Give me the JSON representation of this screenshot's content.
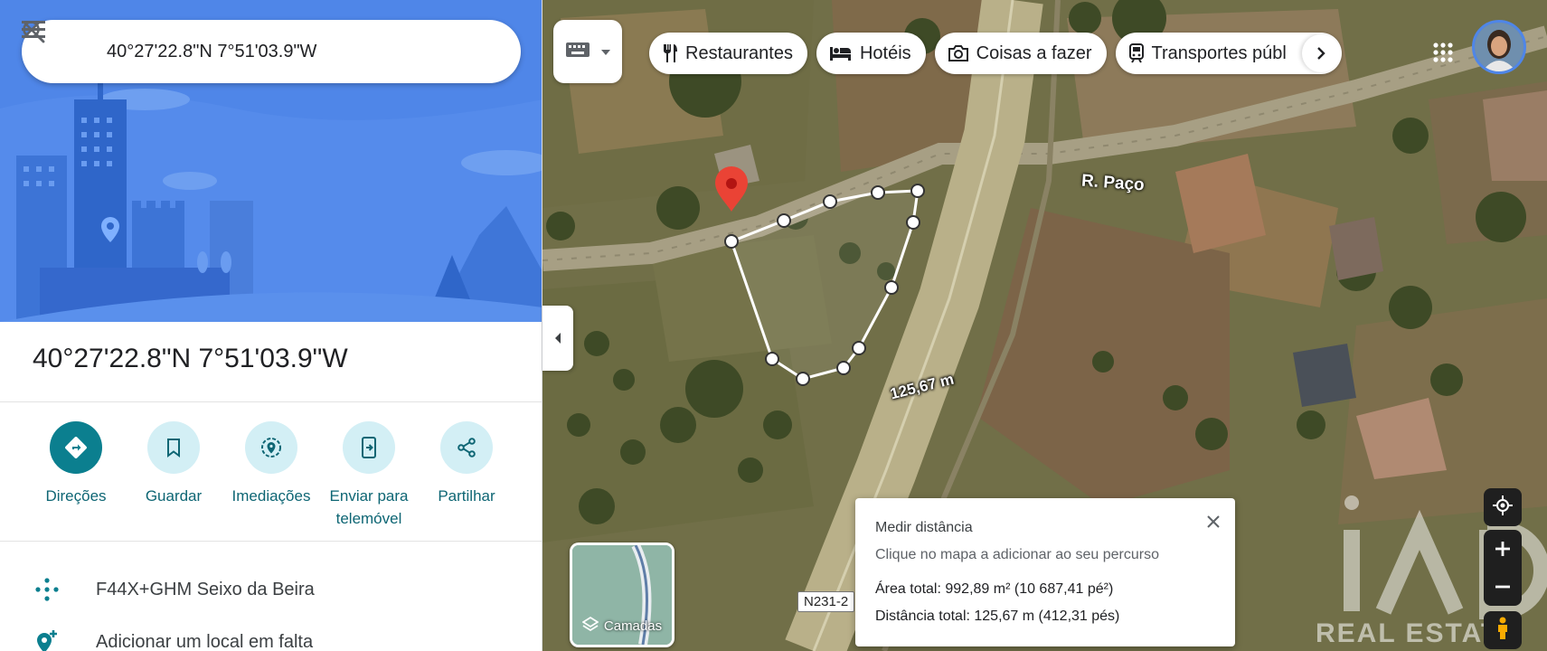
{
  "search": {
    "query": "40°27'22.8\"N 7°51'03.9\"W"
  },
  "place": {
    "title": "40°27'22.8\"N 7°51'03.9\"W"
  },
  "actions": [
    {
      "label": "Direções",
      "icon": "directions-icon"
    },
    {
      "label": "Guardar",
      "icon": "bookmark-icon"
    },
    {
      "label": "Imediações",
      "icon": "nearby-icon"
    },
    {
      "label": "Enviar para telemóvel",
      "icon": "send-to-phone-icon"
    },
    {
      "label": "Partilhar",
      "icon": "share-icon"
    }
  ],
  "info": {
    "plus_code": "F44X+GHM Seixo da Beira",
    "add_place": "Adicionar um local em falta"
  },
  "chips": [
    {
      "label": "Restaurantes",
      "icon": "restaurant-icon"
    },
    {
      "label": "Hotéis",
      "icon": "hotel-icon"
    },
    {
      "label": "Coisas a fazer",
      "icon": "camera-icon"
    },
    {
      "label": "Transportes públ",
      "icon": "transit-icon"
    }
  ],
  "map": {
    "street_label": "R. Paço",
    "road_code": "N231-2",
    "segment_label": "125,67 m",
    "layers_label": "Camadas",
    "watermark": "REAL ESTATE"
  },
  "measure": {
    "title": "Medir distância",
    "hint": "Clique no mapa a adicionar ao seu percurso",
    "area": "Área total: 992,89 m² (10 687,41 pé²)",
    "distance": "Distância total: 125,67 m (412,31 pés)"
  },
  "colors": {
    "accent": "#0b7f8f",
    "hero_blue": "#4f86e8",
    "pin_red": "#ea4335"
  }
}
